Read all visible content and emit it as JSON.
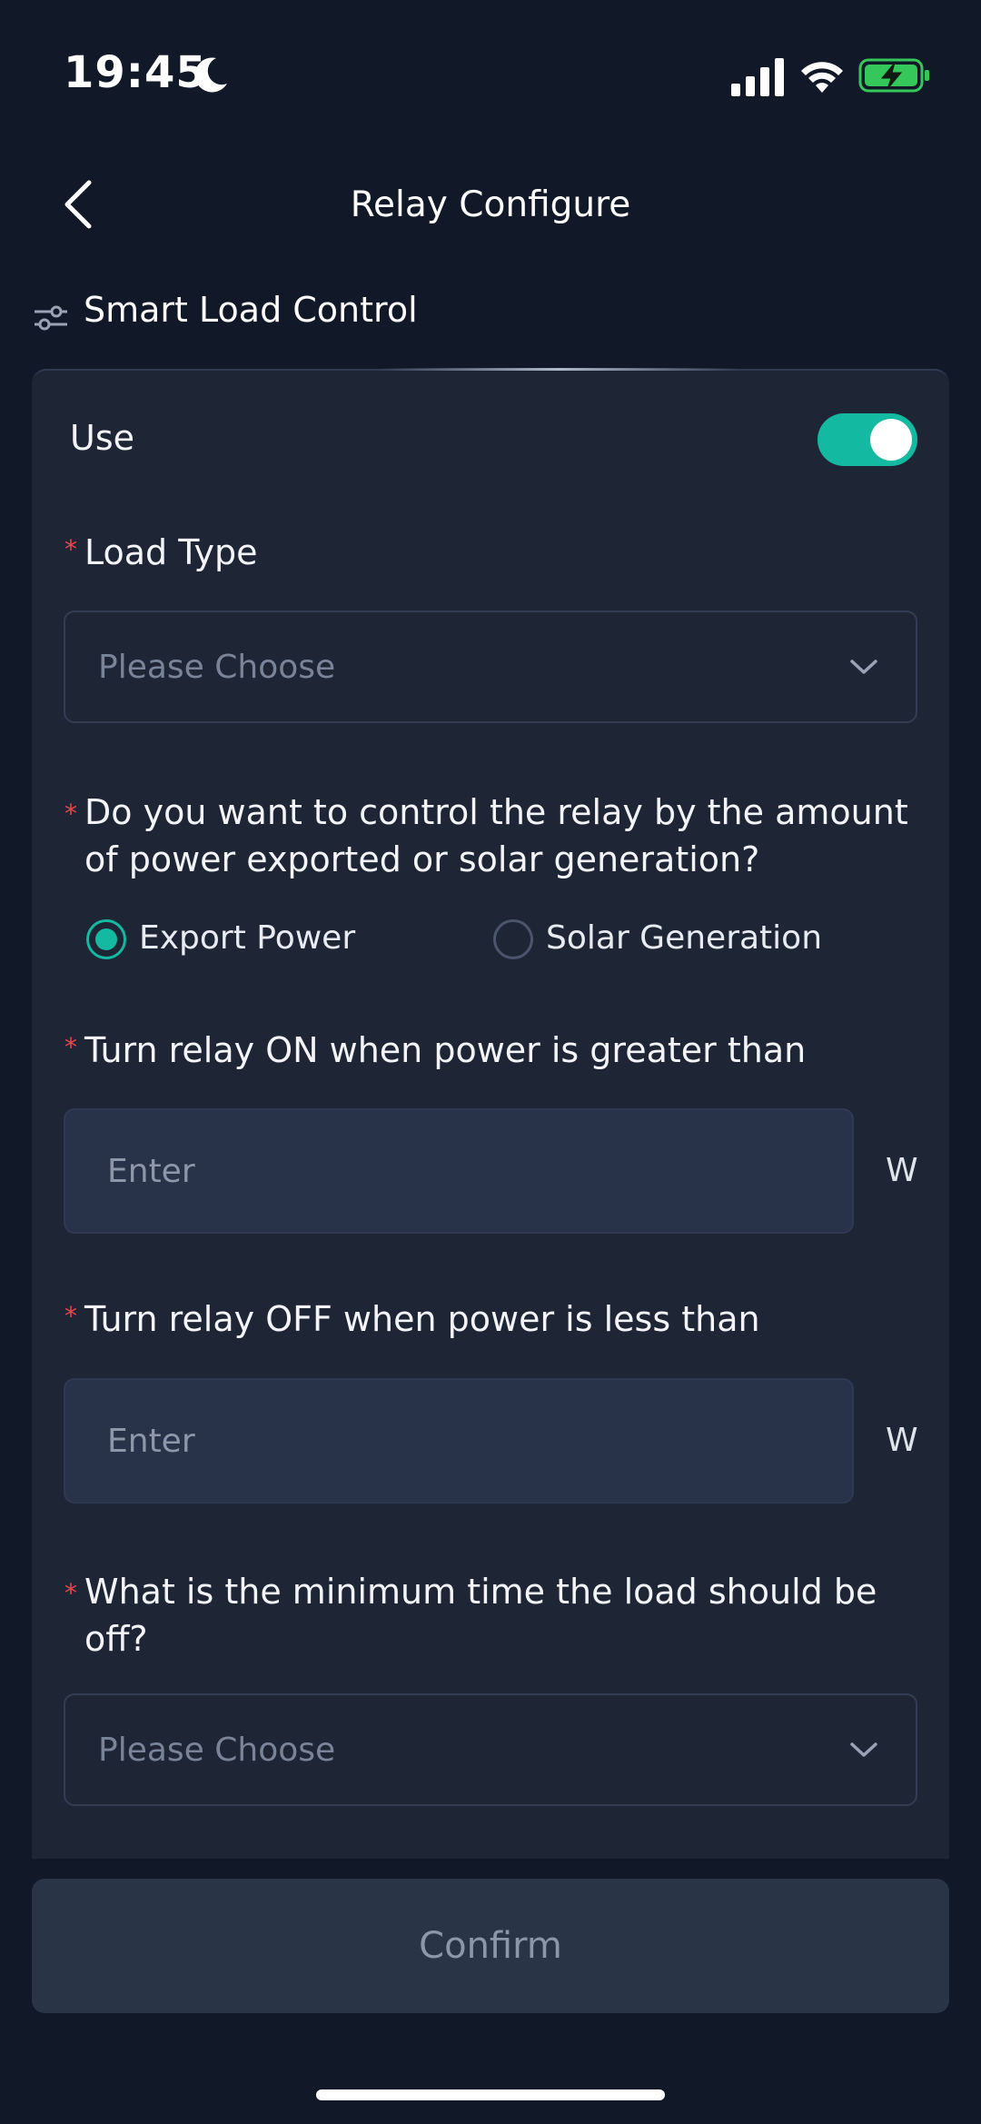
{
  "status_bar": {
    "time": "19:45",
    "icons": [
      "moon-icon",
      "cellular-signal-icon",
      "wifi-icon",
      "battery-charging-icon"
    ],
    "battery_color": "#35c759"
  },
  "nav": {
    "title": "Relay Configure",
    "back_icon": "chevron-left-icon"
  },
  "section": {
    "title": "Smart Load Control",
    "icon": "sliders-icon"
  },
  "form": {
    "use_label": "Use",
    "use_enabled": true,
    "accent_color": "#14b9a2",
    "required_mark": "*",
    "load_type": {
      "label": "Load Type",
      "placeholder": "Please Choose"
    },
    "control_mode": {
      "question": "Do you want to control the relay by the amount of power exported or solar generation?",
      "options": [
        {
          "label": "Export Power",
          "selected": true
        },
        {
          "label": "Solar Generation",
          "selected": false
        }
      ]
    },
    "on_threshold": {
      "label": "Turn relay ON when power is greater than",
      "placeholder": "Enter",
      "unit": "W"
    },
    "off_threshold": {
      "label": "Turn relay OFF when power is less than",
      "placeholder": "Enter",
      "unit": "W"
    },
    "min_off_time": {
      "question": "What is the minimum time the load should be off?",
      "placeholder": "Please Choose"
    }
  },
  "footer": {
    "confirm_label": "Confirm"
  }
}
